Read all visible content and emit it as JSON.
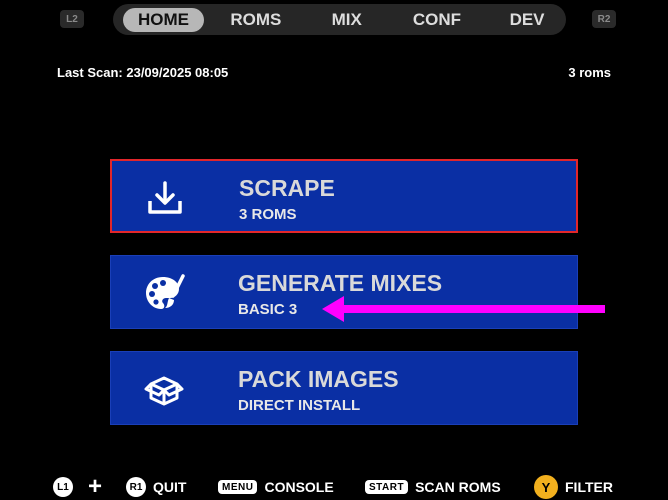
{
  "shoulders": {
    "left": "L2",
    "right": "R2"
  },
  "tabs": [
    {
      "label": "HOME",
      "active": true
    },
    {
      "label": "ROMS",
      "active": false
    },
    {
      "label": "MIX",
      "active": false
    },
    {
      "label": "CONF",
      "active": false
    },
    {
      "label": "DEV",
      "active": false
    }
  ],
  "status": {
    "last_scan": "Last Scan: 23/09/2025 08:05",
    "rom_count": "3 roms"
  },
  "menu": [
    {
      "title": "SCRAPE",
      "subtitle": "3 ROMS",
      "icon": "download-icon",
      "selected": true
    },
    {
      "title": "GENERATE MIXES",
      "subtitle": "BASIC 3",
      "icon": "palette-icon",
      "selected": false
    },
    {
      "title": "PACK IMAGES",
      "subtitle": "DIRECT INSTALL",
      "icon": "box-icon",
      "selected": false
    }
  ],
  "footer": {
    "l1": "L1",
    "plus": "+",
    "r1": "R1",
    "quit": "QUIT",
    "menu_key": "MENU",
    "console": "CONSOLE",
    "start_key": "START",
    "scan_roms": "SCAN ROMS",
    "y_key": "Y",
    "filter": "FILTER"
  },
  "colors": {
    "button_bg": "#0a2fa4",
    "selected_border": "#e2262b",
    "arrow": "#ff00ff",
    "tab_active": "#b7b7b7",
    "y_button": "#f2b01e"
  }
}
